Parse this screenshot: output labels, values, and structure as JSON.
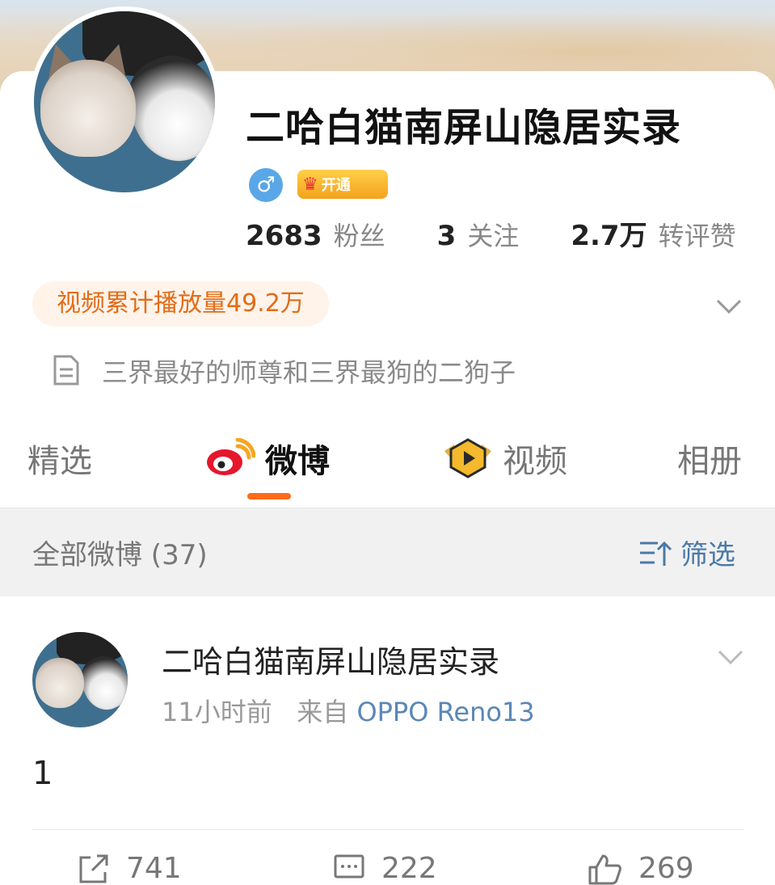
{
  "profile": {
    "name": "二哈白猫南屏山隐居实录",
    "gender_symbol": "♂",
    "vip_label": "开通",
    "stats": [
      {
        "value": "2683",
        "label": "粉丝"
      },
      {
        "value": "3",
        "label": "关注"
      },
      {
        "value": "2.7万",
        "label": "转评赞"
      }
    ],
    "video_plays": "视频累计播放量49.2万",
    "intro": "三界最好的师尊和三界最狗的二狗子"
  },
  "tabs": [
    {
      "label": "精选",
      "active": false
    },
    {
      "label": "微博",
      "active": true
    },
    {
      "label": "视频",
      "active": false
    },
    {
      "label": "相册",
      "active": false
    }
  ],
  "filter": {
    "title": "全部微博 (37)",
    "button_label": "筛选"
  },
  "post": {
    "author": "二哈白猫南屏山隐居实录",
    "time": "11小时前",
    "source_prefix": "来自",
    "source": "OPPO Reno13",
    "text": "1",
    "actions": {
      "repost": "741",
      "comment": "222",
      "like": "269"
    }
  },
  "colors": {
    "accent": "#ff6a1a",
    "link": "#4a79a8",
    "pill_text": "#e26c17",
    "pill_bg": "#fff3ea"
  }
}
